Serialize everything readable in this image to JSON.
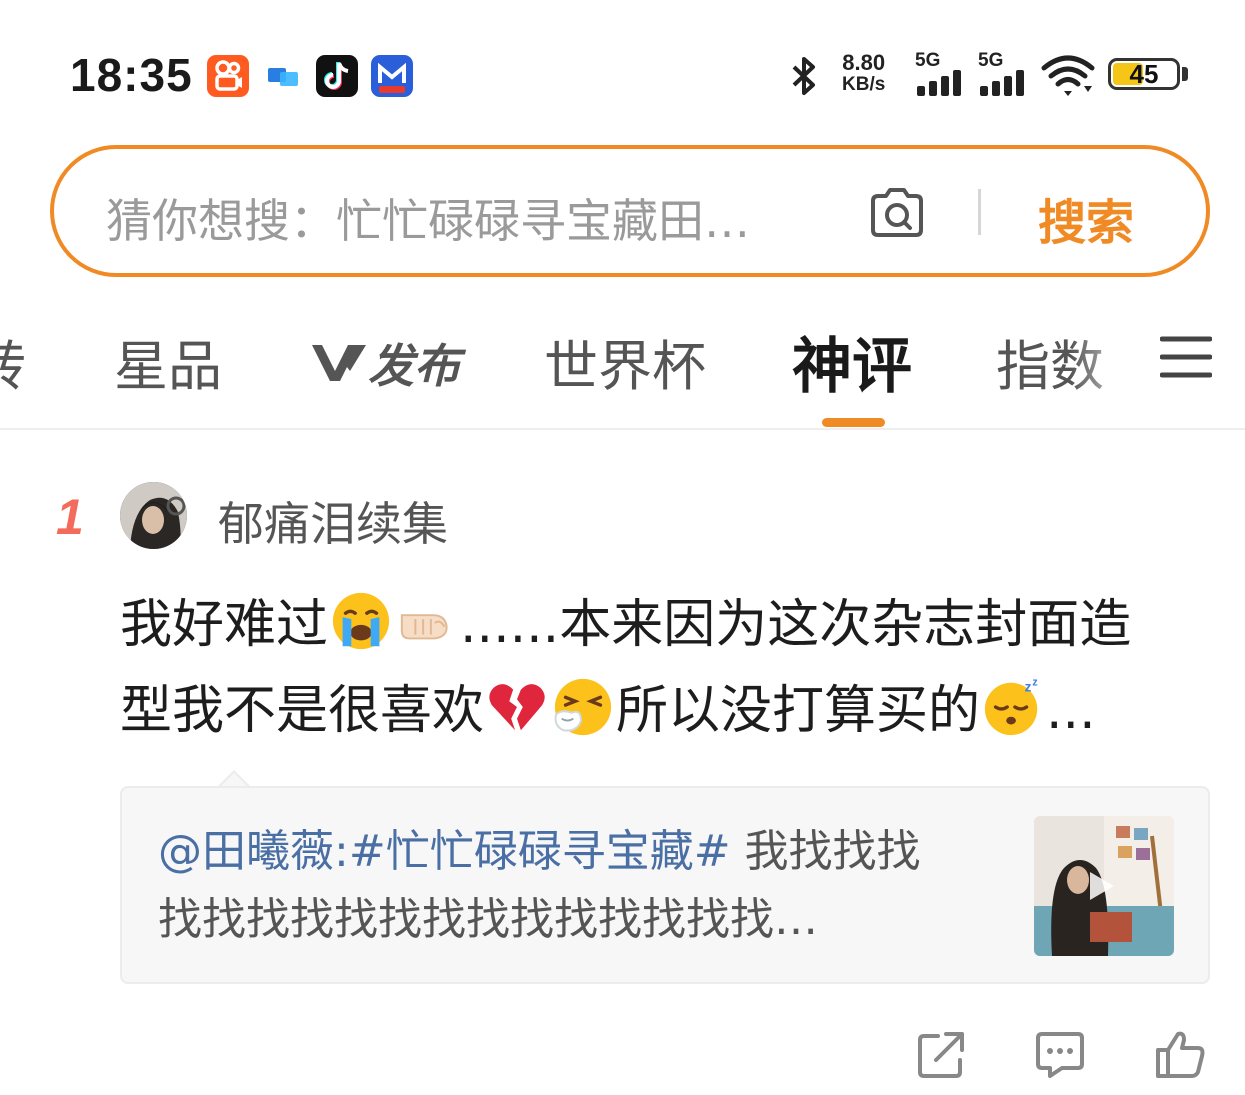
{
  "status_bar": {
    "time": "18:35",
    "apps": [
      "kuaishou-icon",
      "message-app-icon",
      "tiktok-icon",
      "news-app-icon"
    ],
    "network_speed_value": "8.80",
    "network_speed_unit": "KB/s",
    "sim1_label": "5G",
    "sim2_label": "5G",
    "battery_level": "45"
  },
  "search": {
    "placeholder": "猜你想搜：忙忙碌碌寻宝藏田…",
    "button_label": "搜索",
    "accent_color": "#f08a24"
  },
  "tabs": {
    "items": [
      {
        "label": "转",
        "partial": true
      },
      {
        "label": "星品"
      },
      {
        "label": "发布",
        "brand": "V"
      },
      {
        "label": "世界杯"
      },
      {
        "label": "神评",
        "active": true
      },
      {
        "label": "指数"
      }
    ]
  },
  "comment": {
    "rank": "1",
    "username": "郁痛泪续集",
    "line1": {
      "a": "我好难过",
      "b": "......本来因为这次杂志封面造"
    },
    "line2": {
      "a": "型我不是很喜欢",
      "b": "所以没打算买的",
      "c": "..."
    },
    "emojis": [
      "crying-face",
      "fist-bump",
      "broken-heart",
      "sneezing-face",
      "sleeping-face"
    ]
  },
  "quote": {
    "mention": "@田曦薇:",
    "topic": "#忙忙碌碌寻宝藏#",
    "text_line1_rest": " 我找找找",
    "text_line2": "找找找找找找找找找找找找找找…",
    "has_video": true
  },
  "actions": [
    "share-icon",
    "comment-icon",
    "like-icon"
  ]
}
